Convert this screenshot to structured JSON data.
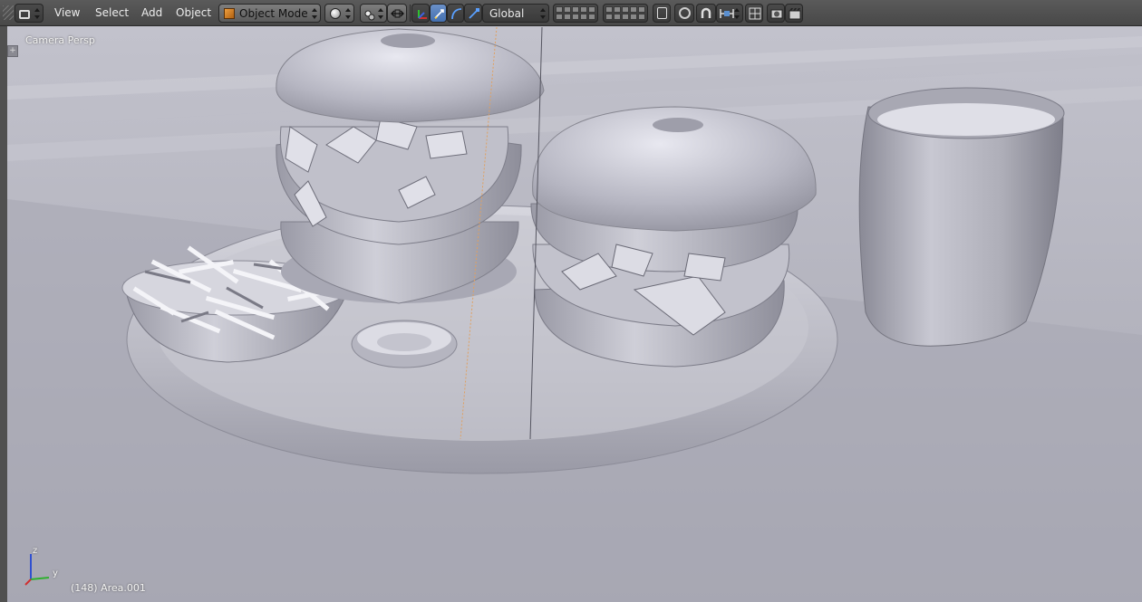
{
  "header": {
    "menus": [
      "View",
      "Select",
      "Add",
      "Object"
    ],
    "mode": "Object Mode",
    "orientation": "Global"
  },
  "viewport": {
    "view_name": "Camera Persp",
    "status": "(148) Area.001",
    "axis_labels": {
      "z": "z",
      "y": "y"
    }
  },
  "colors": {
    "header_bg": "#4f4f4f",
    "viewport_bg": "#b9b9c4",
    "active_blue": "#5580bc",
    "axis_x": "#d03030",
    "axis_y": "#30b030",
    "axis_z": "#3050d0"
  },
  "icons": [
    "editor-type-icon",
    "mode-cube-icon",
    "viewport-shading-icon",
    "pivot-point-icon",
    "transform-manipulator-icon",
    "translate-icon",
    "rotate-icon",
    "scale-icon",
    "layers-icon",
    "lock-camera-icon",
    "proportional-edit-icon",
    "snap-icon",
    "snap-target-icon",
    "render-image-icon",
    "render-animation-icon"
  ]
}
